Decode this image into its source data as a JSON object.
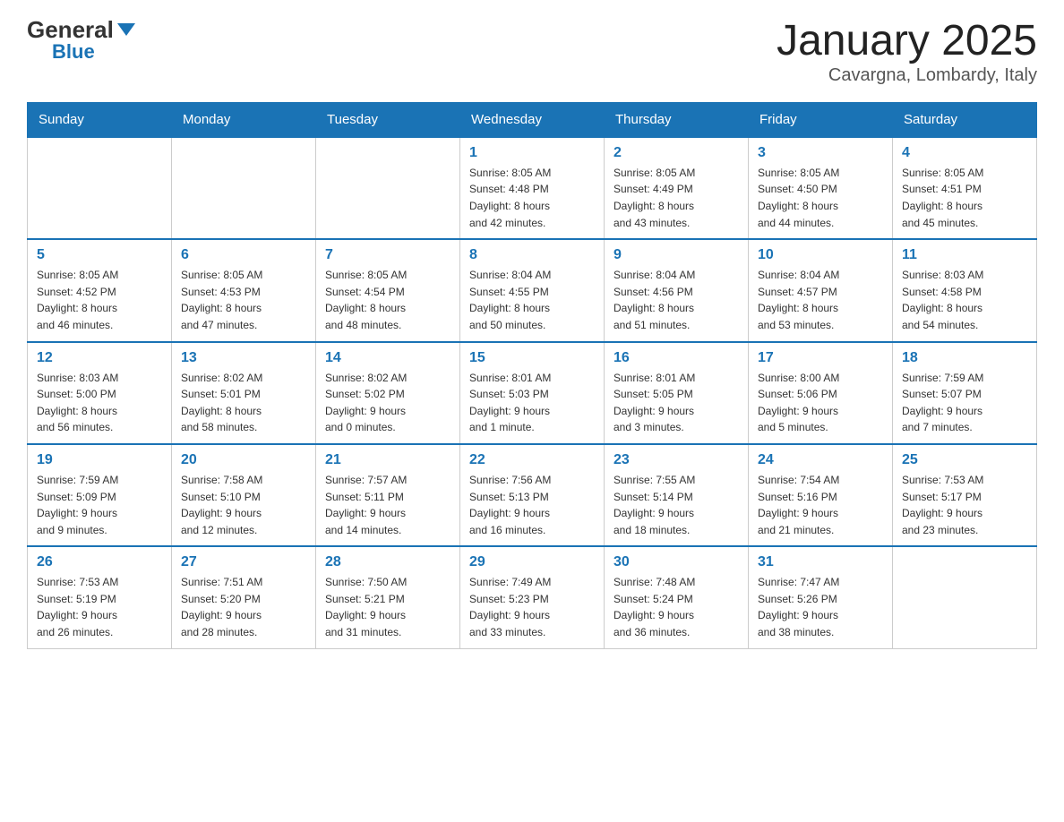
{
  "header": {
    "logo_general": "General",
    "logo_blue": "Blue",
    "title": "January 2025",
    "subtitle": "Cavargna, Lombardy, Italy"
  },
  "days_of_week": [
    "Sunday",
    "Monday",
    "Tuesday",
    "Wednesday",
    "Thursday",
    "Friday",
    "Saturday"
  ],
  "weeks": [
    [
      {
        "day": "",
        "info": ""
      },
      {
        "day": "",
        "info": ""
      },
      {
        "day": "",
        "info": ""
      },
      {
        "day": "1",
        "info": "Sunrise: 8:05 AM\nSunset: 4:48 PM\nDaylight: 8 hours\nand 42 minutes."
      },
      {
        "day": "2",
        "info": "Sunrise: 8:05 AM\nSunset: 4:49 PM\nDaylight: 8 hours\nand 43 minutes."
      },
      {
        "day": "3",
        "info": "Sunrise: 8:05 AM\nSunset: 4:50 PM\nDaylight: 8 hours\nand 44 minutes."
      },
      {
        "day": "4",
        "info": "Sunrise: 8:05 AM\nSunset: 4:51 PM\nDaylight: 8 hours\nand 45 minutes."
      }
    ],
    [
      {
        "day": "5",
        "info": "Sunrise: 8:05 AM\nSunset: 4:52 PM\nDaylight: 8 hours\nand 46 minutes."
      },
      {
        "day": "6",
        "info": "Sunrise: 8:05 AM\nSunset: 4:53 PM\nDaylight: 8 hours\nand 47 minutes."
      },
      {
        "day": "7",
        "info": "Sunrise: 8:05 AM\nSunset: 4:54 PM\nDaylight: 8 hours\nand 48 minutes."
      },
      {
        "day": "8",
        "info": "Sunrise: 8:04 AM\nSunset: 4:55 PM\nDaylight: 8 hours\nand 50 minutes."
      },
      {
        "day": "9",
        "info": "Sunrise: 8:04 AM\nSunset: 4:56 PM\nDaylight: 8 hours\nand 51 minutes."
      },
      {
        "day": "10",
        "info": "Sunrise: 8:04 AM\nSunset: 4:57 PM\nDaylight: 8 hours\nand 53 minutes."
      },
      {
        "day": "11",
        "info": "Sunrise: 8:03 AM\nSunset: 4:58 PM\nDaylight: 8 hours\nand 54 minutes."
      }
    ],
    [
      {
        "day": "12",
        "info": "Sunrise: 8:03 AM\nSunset: 5:00 PM\nDaylight: 8 hours\nand 56 minutes."
      },
      {
        "day": "13",
        "info": "Sunrise: 8:02 AM\nSunset: 5:01 PM\nDaylight: 8 hours\nand 58 minutes."
      },
      {
        "day": "14",
        "info": "Sunrise: 8:02 AM\nSunset: 5:02 PM\nDaylight: 9 hours\nand 0 minutes."
      },
      {
        "day": "15",
        "info": "Sunrise: 8:01 AM\nSunset: 5:03 PM\nDaylight: 9 hours\nand 1 minute."
      },
      {
        "day": "16",
        "info": "Sunrise: 8:01 AM\nSunset: 5:05 PM\nDaylight: 9 hours\nand 3 minutes."
      },
      {
        "day": "17",
        "info": "Sunrise: 8:00 AM\nSunset: 5:06 PM\nDaylight: 9 hours\nand 5 minutes."
      },
      {
        "day": "18",
        "info": "Sunrise: 7:59 AM\nSunset: 5:07 PM\nDaylight: 9 hours\nand 7 minutes."
      }
    ],
    [
      {
        "day": "19",
        "info": "Sunrise: 7:59 AM\nSunset: 5:09 PM\nDaylight: 9 hours\nand 9 minutes."
      },
      {
        "day": "20",
        "info": "Sunrise: 7:58 AM\nSunset: 5:10 PM\nDaylight: 9 hours\nand 12 minutes."
      },
      {
        "day": "21",
        "info": "Sunrise: 7:57 AM\nSunset: 5:11 PM\nDaylight: 9 hours\nand 14 minutes."
      },
      {
        "day": "22",
        "info": "Sunrise: 7:56 AM\nSunset: 5:13 PM\nDaylight: 9 hours\nand 16 minutes."
      },
      {
        "day": "23",
        "info": "Sunrise: 7:55 AM\nSunset: 5:14 PM\nDaylight: 9 hours\nand 18 minutes."
      },
      {
        "day": "24",
        "info": "Sunrise: 7:54 AM\nSunset: 5:16 PM\nDaylight: 9 hours\nand 21 minutes."
      },
      {
        "day": "25",
        "info": "Sunrise: 7:53 AM\nSunset: 5:17 PM\nDaylight: 9 hours\nand 23 minutes."
      }
    ],
    [
      {
        "day": "26",
        "info": "Sunrise: 7:53 AM\nSunset: 5:19 PM\nDaylight: 9 hours\nand 26 minutes."
      },
      {
        "day": "27",
        "info": "Sunrise: 7:51 AM\nSunset: 5:20 PM\nDaylight: 9 hours\nand 28 minutes."
      },
      {
        "day": "28",
        "info": "Sunrise: 7:50 AM\nSunset: 5:21 PM\nDaylight: 9 hours\nand 31 minutes."
      },
      {
        "day": "29",
        "info": "Sunrise: 7:49 AM\nSunset: 5:23 PM\nDaylight: 9 hours\nand 33 minutes."
      },
      {
        "day": "30",
        "info": "Sunrise: 7:48 AM\nSunset: 5:24 PM\nDaylight: 9 hours\nand 36 minutes."
      },
      {
        "day": "31",
        "info": "Sunrise: 7:47 AM\nSunset: 5:26 PM\nDaylight: 9 hours\nand 38 minutes."
      },
      {
        "day": "",
        "info": ""
      }
    ]
  ]
}
